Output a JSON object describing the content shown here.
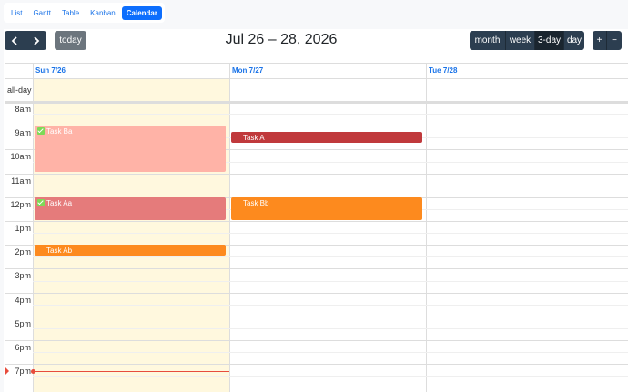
{
  "view_tabs": [
    {
      "label": "List",
      "active": false
    },
    {
      "label": "Gantt",
      "active": false
    },
    {
      "label": "Table",
      "active": false
    },
    {
      "label": "Kanban",
      "active": false
    },
    {
      "label": "Calendar",
      "active": true
    }
  ],
  "toolbar": {
    "prev_icon": "chevron-left-icon",
    "next_icon": "chevron-right-icon",
    "today_label": "today",
    "title": "Jul 26 – 28, 2026",
    "views": [
      {
        "label": "month",
        "active": false
      },
      {
        "label": "week",
        "active": false
      },
      {
        "label": "3-day",
        "active": true
      },
      {
        "label": "day",
        "active": false
      }
    ],
    "zoom_in": "+",
    "zoom_out": "−"
  },
  "calendar": {
    "columns": [
      "Sun 7/26",
      "Mon 7/27",
      "Tue 7/28"
    ],
    "allday_label": "all-day",
    "time_labels": [
      "8am",
      "9am",
      "10am",
      "11am",
      "12pm",
      "1pm",
      "2pm",
      "3pm",
      "4pm",
      "5pm",
      "6pm",
      "7pm"
    ],
    "events": [
      {
        "title": "Task Ba",
        "day": 0,
        "start": 9.0,
        "end": 11.0,
        "color": "#ffb3a7",
        "checked": true
      },
      {
        "title": "Task Aa",
        "day": 0,
        "start": 12.0,
        "end": 13.0,
        "color": "#e57b7b",
        "checked": true
      },
      {
        "title": "Task Ab",
        "day": 0,
        "start": 14.0,
        "end": 14.5,
        "color": "#fd8a1e",
        "checked": false
      },
      {
        "title": "Task A",
        "day": 1,
        "start": 9.25,
        "end": 9.75,
        "color": "#c0393c",
        "checked": false
      },
      {
        "title": "Task Bb",
        "day": 1,
        "start": 12.0,
        "end": 13.0,
        "color": "#fd8a1e",
        "checked": false
      }
    ],
    "now_hour": 19.0,
    "colors": {
      "today_bg": "#fff8de",
      "header_text": "#1a73e8",
      "now_indicator": "#e74c3c"
    }
  }
}
